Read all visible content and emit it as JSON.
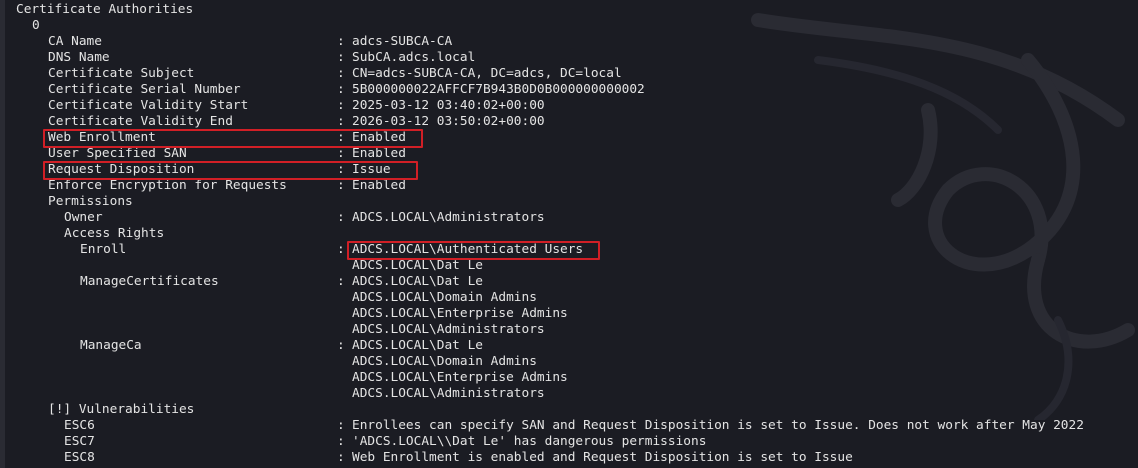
{
  "terminal": {
    "lines": [
      {
        "indent": 16,
        "key": "Certificate Authorities",
        "value": ""
      },
      {
        "indent": 32,
        "key": "0",
        "value": ""
      },
      {
        "indent": 48,
        "key": "CA Name",
        "value": "adcs-SUBCA-CA"
      },
      {
        "indent": 48,
        "key": "DNS Name",
        "value": "SubCA.adcs.local"
      },
      {
        "indent": 48,
        "key": "Certificate Subject",
        "value": "CN=adcs-SUBCA-CA, DC=adcs, DC=local"
      },
      {
        "indent": 48,
        "key": "Certificate Serial Number",
        "value": "5B000000022AFFCF7B943B0D0B000000000002"
      },
      {
        "indent": 48,
        "key": "Certificate Validity Start",
        "value": "2025-03-12 03:40:02+00:00"
      },
      {
        "indent": 48,
        "key": "Certificate Validity End",
        "value": "2026-03-12 03:50:02+00:00"
      },
      {
        "indent": 48,
        "key": "Web Enrollment",
        "value": "Enabled"
      },
      {
        "indent": 48,
        "key": "User Specified SAN",
        "value": "Enabled"
      },
      {
        "indent": 48,
        "key": "Request Disposition",
        "value": "Issue"
      },
      {
        "indent": 48,
        "key": "Enforce Encryption for Requests",
        "value": "Enabled"
      },
      {
        "indent": 48,
        "key": "Permissions",
        "value": ""
      },
      {
        "indent": 64,
        "key": "Owner",
        "value": "ADCS.LOCAL\\Administrators"
      },
      {
        "indent": 64,
        "key": "Access Rights",
        "value": ""
      },
      {
        "indent": 80,
        "key": "Enroll",
        "value": "ADCS.LOCAL\\Authenticated Users"
      },
      {
        "indent": 80,
        "key": "",
        "value": "ADCS.LOCAL\\Dat Le",
        "cont": true
      },
      {
        "indent": 80,
        "key": "ManageCertificates",
        "value": "ADCS.LOCAL\\Dat Le"
      },
      {
        "indent": 80,
        "key": "",
        "value": "ADCS.LOCAL\\Domain Admins",
        "cont": true
      },
      {
        "indent": 80,
        "key": "",
        "value": "ADCS.LOCAL\\Enterprise Admins",
        "cont": true
      },
      {
        "indent": 80,
        "key": "",
        "value": "ADCS.LOCAL\\Administrators",
        "cont": true
      },
      {
        "indent": 80,
        "key": "ManageCa",
        "value": "ADCS.LOCAL\\Dat Le"
      },
      {
        "indent": 80,
        "key": "",
        "value": "ADCS.LOCAL\\Domain Admins",
        "cont": true
      },
      {
        "indent": 80,
        "key": "",
        "value": "ADCS.LOCAL\\Enterprise Admins",
        "cont": true
      },
      {
        "indent": 80,
        "key": "",
        "value": "ADCS.LOCAL\\Administrators",
        "cont": true
      },
      {
        "indent": 48,
        "key": "[!] Vulnerabilities",
        "value": ""
      },
      {
        "indent": 64,
        "key": "ESC6",
        "value": "Enrollees can specify SAN and Request Disposition is set to Issue. Does not work after May 2022"
      },
      {
        "indent": 64,
        "key": "ESC7",
        "value": "'ADCS.LOCAL\\\\Dat Le' has dangerous permissions"
      },
      {
        "indent": 64,
        "key": "ESC8",
        "value": "Web Enrollment is enabled and Request Disposition is set to Issue"
      }
    ],
    "separator": ":",
    "highlighted_lines": [
      8,
      10,
      15
    ]
  },
  "colors": {
    "background": "#1b1c23",
    "text": "#e4e4e4",
    "highlight_border": "#d11f26"
  },
  "icons": {
    "background_logo": "kali-dragon-icon"
  }
}
